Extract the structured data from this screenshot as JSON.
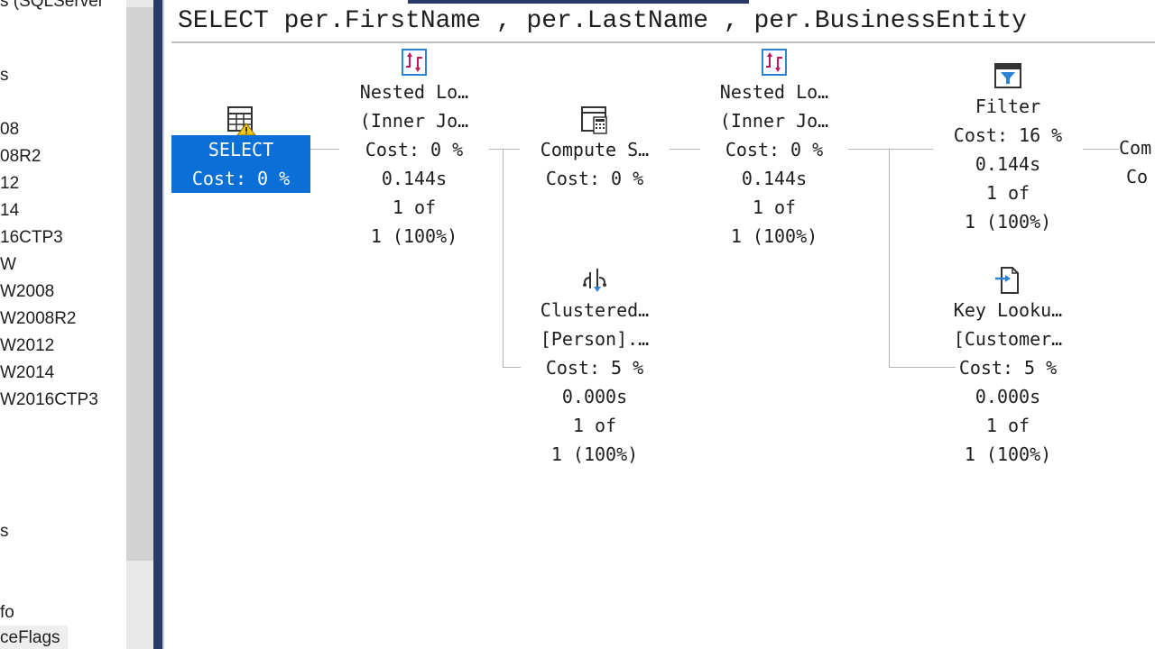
{
  "explorer": {
    "items": [
      {
        "label": "s (SQLServer"
      },
      {
        "label": "s"
      },
      {
        "label": "08"
      },
      {
        "label": "08R2"
      },
      {
        "label": "12"
      },
      {
        "label": "14"
      },
      {
        "label": "16CTP3"
      },
      {
        "label": "W"
      },
      {
        "label": "W2008"
      },
      {
        "label": "W2008R2"
      },
      {
        "label": "W2012"
      },
      {
        "label": "W2014"
      },
      {
        "label": "W2016CTP3"
      },
      {
        "label": "s"
      },
      {
        "label": "fo"
      },
      {
        "label": "ceFlags"
      }
    ]
  },
  "query": {
    "text": "SELECT per.FirstName , per.LastName , per.BusinessEntity"
  },
  "plan": {
    "select": {
      "name": "SELECT",
      "cost": "Cost: 0 %",
      "icon": "select-result-warning-icon"
    },
    "nested1": {
      "name": "Nested Lo…",
      "sub": "(Inner Jo…",
      "cost": "Cost: 0 %",
      "time": "0.144s",
      "rows": "1 of",
      "est": "1 (100%)",
      "icon": "nested-loops-icon"
    },
    "compute": {
      "name": "Compute S…",
      "cost": "Cost: 0 %",
      "icon": "compute-scalar-icon"
    },
    "nested2": {
      "name": "Nested Lo…",
      "sub": "(Inner Jo…",
      "cost": "Cost: 0 %",
      "time": "0.144s",
      "rows": "1 of",
      "est": "1 (100%)",
      "icon": "nested-loops-icon"
    },
    "filter": {
      "name": "Filter",
      "cost": "Cost: 16 %",
      "time": "0.144s",
      "rows": "1 of",
      "est": "1 (100%)",
      "icon": "filter-icon"
    },
    "clustered": {
      "name": "Clustered…",
      "sub": "[Person].…",
      "cost": "Cost: 5 %",
      "time": "0.000s",
      "rows": "1 of",
      "est": "1 (100%)",
      "icon": "clustered-index-seek-icon"
    },
    "keylookup": {
      "name": "Key Looku…",
      "sub": "[Customer…",
      "cost": "Cost: 5 %",
      "time": "0.000s",
      "rows": "1 of",
      "est": "1 (100%)",
      "icon": "key-lookup-icon"
    },
    "partial": {
      "name": "Com",
      "cost": "Co"
    }
  },
  "colors": {
    "selection": "#0a6fd6",
    "splitter": "#2a3a66",
    "connector": "#b5b5b5"
  }
}
